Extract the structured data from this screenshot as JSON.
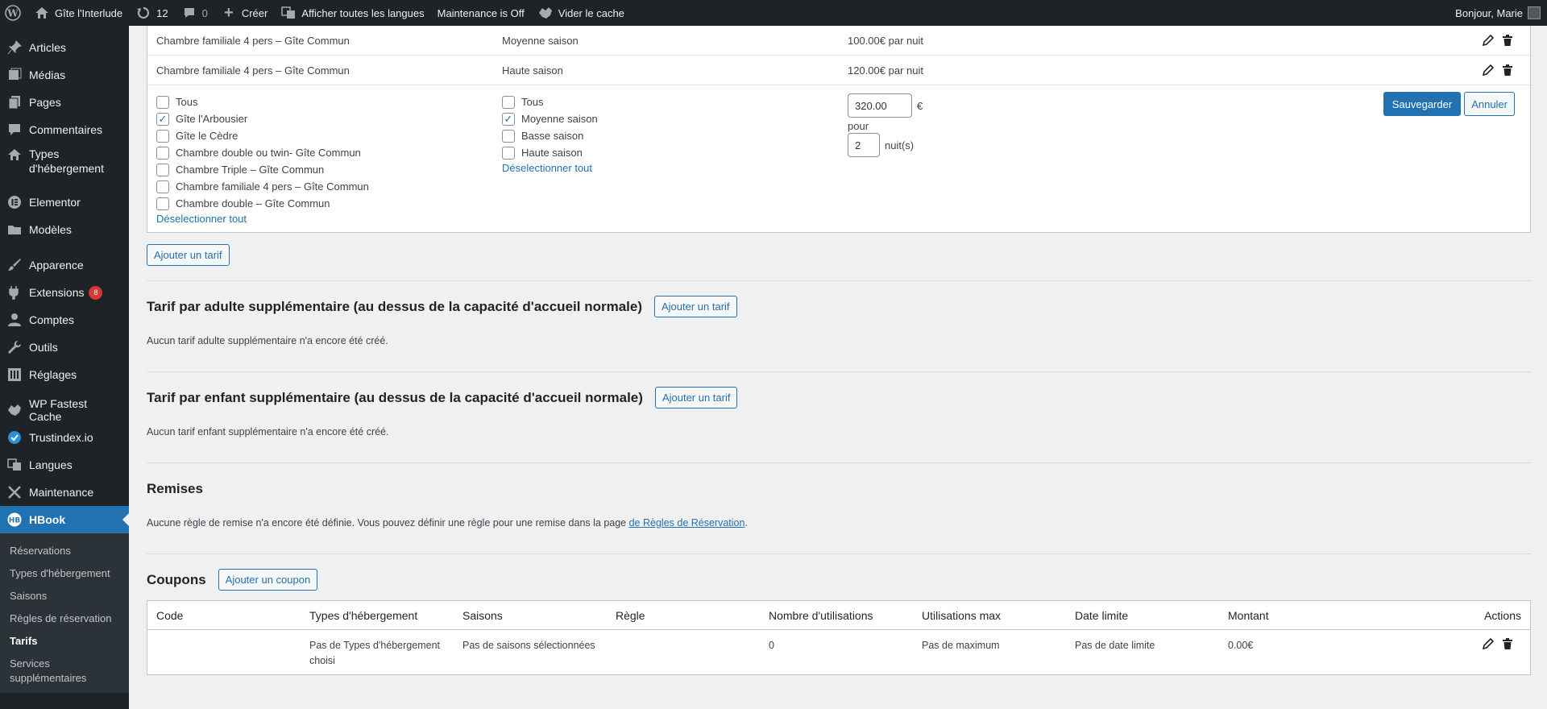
{
  "adminbar": {
    "site_name": "Gîte l'Interlude",
    "updates_count": "12",
    "comments_count": "0",
    "new_label": "Créer",
    "languages_label": "Afficher toutes les langues",
    "maintenance_label": "Maintenance is Off",
    "cache_label": "Vider le cache",
    "greeting": "Bonjour, Marie"
  },
  "sidebar": {
    "items": [
      {
        "label": "Articles",
        "icon": "pin-icon"
      },
      {
        "label": "Médias",
        "icon": "media-icon"
      },
      {
        "label": "Pages",
        "icon": "pages-icon"
      },
      {
        "label": "Commentaires",
        "icon": "comments-icon"
      },
      {
        "label": "Types d'hébergement",
        "icon": "home-icon"
      },
      {
        "label": "Elementor",
        "icon": "elementor-icon"
      },
      {
        "label": "Modèles",
        "icon": "folder-icon"
      },
      {
        "label": "Apparence",
        "icon": "brush-icon"
      },
      {
        "label": "Extensions",
        "icon": "plugin-icon",
        "badge": "8"
      },
      {
        "label": "Comptes",
        "icon": "user-icon"
      },
      {
        "label": "Outils",
        "icon": "wrench-icon"
      },
      {
        "label": "Réglages",
        "icon": "settings-icon"
      },
      {
        "label": "WP Fastest Cache",
        "icon": "cheetah-icon"
      },
      {
        "label": "Trustindex.io",
        "icon": "check-circle-icon"
      },
      {
        "label": "Langues",
        "icon": "translate-icon"
      },
      {
        "label": "Maintenance",
        "icon": "tools-icon"
      },
      {
        "label": "HBook",
        "icon": "hb-icon"
      }
    ],
    "submenu": [
      "Réservations",
      "Types d'hébergement",
      "Saisons",
      "Règles de réservation",
      "Tarifs",
      "Services supplémentaires"
    ]
  },
  "rates": {
    "rows": [
      {
        "accom": "Chambre familiale 4 pers – Gîte Commun",
        "season": "Moyenne saison",
        "price": "100.00€ par nuit"
      },
      {
        "accom": "Chambre familiale 4 pers – Gîte Commun",
        "season": "Haute saison",
        "price": "120.00€ par nuit"
      }
    ],
    "edit": {
      "accom_options": [
        {
          "label": "Tous",
          "checked": false
        },
        {
          "label": "Gîte l'Arbousier",
          "checked": true
        },
        {
          "label": "Gîte le Cèdre",
          "checked": false
        },
        {
          "label": "Chambre double ou twin- Gîte Commun",
          "checked": false
        },
        {
          "label": "Chambre Triple – Gîte Commun",
          "checked": false
        },
        {
          "label": "Chambre familiale 4 pers – Gîte Commun",
          "checked": false
        },
        {
          "label": "Chambre double – Gîte Commun",
          "checked": false
        }
      ],
      "season_options": [
        {
          "label": "Tous",
          "checked": false
        },
        {
          "label": "Moyenne saison",
          "checked": true
        },
        {
          "label": "Basse saison",
          "checked": false
        },
        {
          "label": "Haute saison",
          "checked": false
        }
      ],
      "deselect_label": "Déselectionner tout",
      "price_value": "320.00",
      "currency": "€",
      "for_label": "pour",
      "nights_value": "2",
      "nights_unit": "nuit(s)",
      "save_label": "Sauvegarder",
      "cancel_label": "Annuler"
    },
    "add_label": "Ajouter un tarif"
  },
  "adult": {
    "title": "Tarif par adulte supplémentaire (au dessus de la capacité d'accueil normale)",
    "add_label": "Ajouter un tarif",
    "empty_text": "Aucun tarif adulte supplémentaire n'a encore été créé."
  },
  "child": {
    "title": "Tarif par enfant supplémentaire (au dessus de la capacité d'accueil normale)",
    "add_label": "Ajouter un tarif",
    "empty_text": "Aucun tarif enfant supplémentaire n'a encore été créé."
  },
  "discounts": {
    "title": "Remises",
    "text": "Aucune règle de remise n'a encore été définie. Vous pouvez définir une règle pour une remise dans la page ",
    "link": "de Règles de Réservation",
    "text_end": "."
  },
  "coupons": {
    "title": "Coupons",
    "add_label": "Ajouter un coupon",
    "headers": [
      "Code",
      "Types d'hébergement",
      "Saisons",
      "Règle",
      "Nombre d'utilisations",
      "Utilisations max",
      "Date limite",
      "Montant",
      "Actions"
    ],
    "row": [
      "",
      "Pas de Types d'hébergement choisi",
      "Pas de saisons sélectionnées",
      "",
      "0",
      "Pas de maximum",
      "Pas de date limite",
      "0.00€"
    ]
  }
}
